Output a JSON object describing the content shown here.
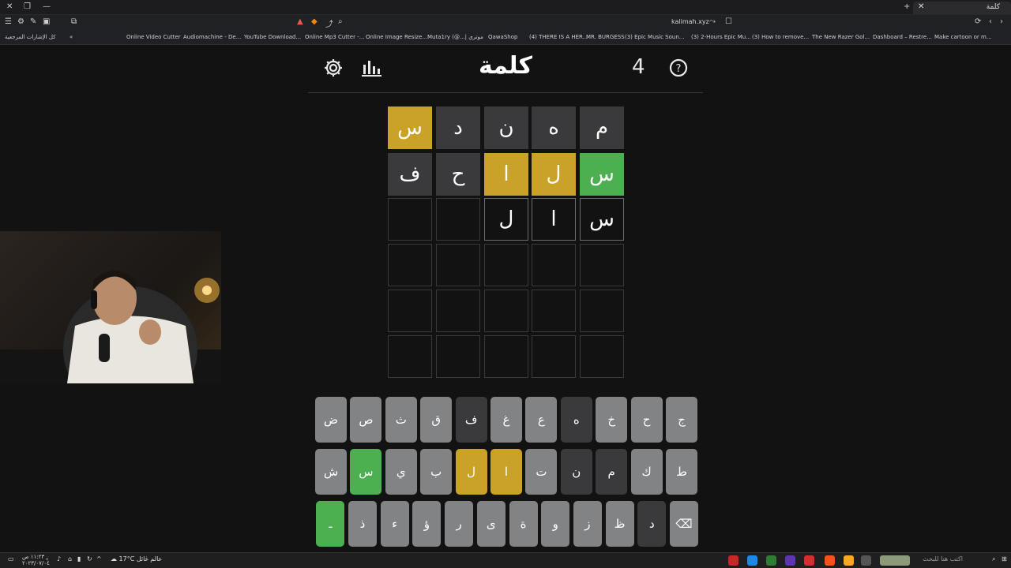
{
  "browser": {
    "tab_title": "كلمة",
    "url": "kalimah.xyz",
    "bookmarks": [
      "كل الإشارات المرجعية",
      "Online Video Cutter",
      "Audiomachine - De...",
      "YouTube Download...",
      "Online Mp3 Cutter -...",
      "Online Image Resize...",
      "Muta1ry (@...| موتري",
      "QawaShop",
      "(4) THERE IS A HER...",
      "MR. BURGESS",
      "(3) Epic Music Soun...",
      "(3) 2-Hours Epic Mu...",
      "(3) How to remove...",
      "The New Razer Gol...",
      "Dashboard – Restre...",
      "Make cartoon or m..."
    ]
  },
  "game": {
    "title": "كلمة",
    "count": "4",
    "board": [
      [
        {
          "letter": "م",
          "state": "absent"
        },
        {
          "letter": "ه",
          "state": "absent"
        },
        {
          "letter": "ن",
          "state": "absent"
        },
        {
          "letter": "د",
          "state": "absent"
        },
        {
          "letter": "س",
          "state": "present"
        }
      ],
      [
        {
          "letter": "س",
          "state": "correct"
        },
        {
          "letter": "ل",
          "state": "present"
        },
        {
          "letter": "ا",
          "state": "present"
        },
        {
          "letter": "ح",
          "state": "absent"
        },
        {
          "letter": "ف",
          "state": "absent"
        }
      ],
      [
        {
          "letter": "س",
          "state": "filled"
        },
        {
          "letter": "ا",
          "state": "filled"
        },
        {
          "letter": "ل",
          "state": "filled"
        },
        {
          "letter": "",
          "state": "empty"
        },
        {
          "letter": "",
          "state": "empty"
        }
      ],
      [
        {
          "letter": "",
          "state": "empty"
        },
        {
          "letter": "",
          "state": "empty"
        },
        {
          "letter": "",
          "state": "empty"
        },
        {
          "letter": "",
          "state": "empty"
        },
        {
          "letter": "",
          "state": "empty"
        }
      ],
      [
        {
          "letter": "",
          "state": "empty"
        },
        {
          "letter": "",
          "state": "empty"
        },
        {
          "letter": "",
          "state": "empty"
        },
        {
          "letter": "",
          "state": "empty"
        },
        {
          "letter": "",
          "state": "empty"
        }
      ],
      [
        {
          "letter": "",
          "state": "empty"
        },
        {
          "letter": "",
          "state": "empty"
        },
        {
          "letter": "",
          "state": "empty"
        },
        {
          "letter": "",
          "state": "empty"
        },
        {
          "letter": "",
          "state": "empty"
        }
      ]
    ],
    "keyboard": [
      [
        {
          "k": "ج",
          "s": "unused"
        },
        {
          "k": "ح",
          "s": "unused"
        },
        {
          "k": "خ",
          "s": "unused"
        },
        {
          "k": "ه",
          "s": "absent"
        },
        {
          "k": "ع",
          "s": "unused"
        },
        {
          "k": "غ",
          "s": "unused"
        },
        {
          "k": "ف",
          "s": "absent"
        },
        {
          "k": "ق",
          "s": "unused"
        },
        {
          "k": "ث",
          "s": "unused"
        },
        {
          "k": "ص",
          "s": "unused"
        },
        {
          "k": "ض",
          "s": "unused"
        }
      ],
      [
        {
          "k": "ط",
          "s": "unused"
        },
        {
          "k": "ك",
          "s": "unused"
        },
        {
          "k": "م",
          "s": "absent"
        },
        {
          "k": "ن",
          "s": "absent"
        },
        {
          "k": "ت",
          "s": "unused"
        },
        {
          "k": "ا",
          "s": "present"
        },
        {
          "k": "ل",
          "s": "present"
        },
        {
          "k": "ب",
          "s": "unused"
        },
        {
          "k": "ي",
          "s": "unused"
        },
        {
          "k": "س",
          "s": "correct"
        },
        {
          "k": "ش",
          "s": "unused"
        }
      ],
      [
        {
          "k": "⌫",
          "s": "action"
        },
        {
          "k": "د",
          "s": "absent"
        },
        {
          "k": "ظ",
          "s": "unused"
        },
        {
          "k": "ز",
          "s": "unused"
        },
        {
          "k": "و",
          "s": "unused"
        },
        {
          "k": "ة",
          "s": "unused"
        },
        {
          "k": "ى",
          "s": "unused"
        },
        {
          "k": "ر",
          "s": "unused"
        },
        {
          "k": "ؤ",
          "s": "unused"
        },
        {
          "k": "ء",
          "s": "unused"
        },
        {
          "k": "ذ",
          "s": "unused"
        },
        {
          "k": "ـ",
          "s": "correct"
        }
      ]
    ]
  },
  "taskbar": {
    "weather": "17°C عالم غائل",
    "clock_time": "١١:٢٣ ص",
    "clock_date": "٢٠٢٣/٠٧/٠٤",
    "search_placeholder": "اكتب هنا للبحث"
  },
  "colors": {
    "correct": "#4caf50",
    "present": "#c9a227",
    "absent": "#3a3a3c",
    "key_default": "#818384",
    "background": "#121213"
  }
}
